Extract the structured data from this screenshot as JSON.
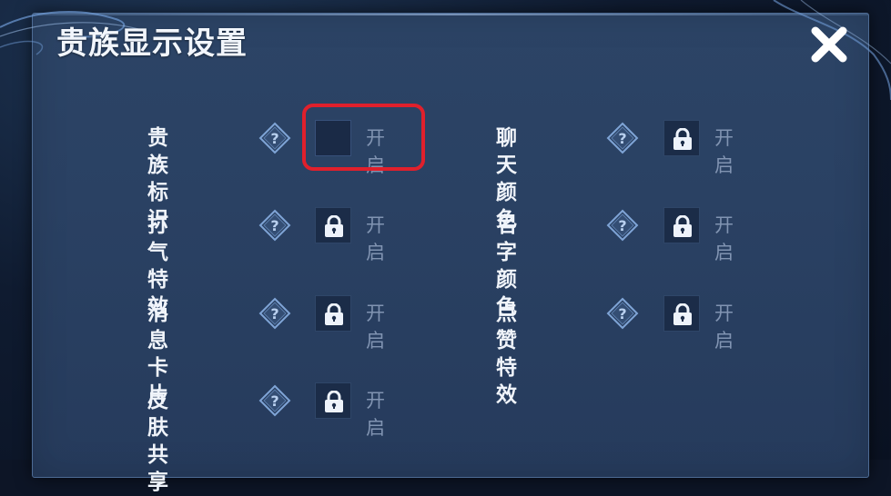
{
  "dialog": {
    "title": "贵族显示设置",
    "close_icon": "close-icon"
  },
  "options": [
    {
      "label": "贵族标识",
      "state": "开启",
      "locked": false,
      "column": "left"
    },
    {
      "label": "聊天颜色",
      "state": "开启",
      "locked": true,
      "column": "right"
    },
    {
      "label": "打气特效",
      "state": "开启",
      "locked": true,
      "column": "left"
    },
    {
      "label": "名字颜色",
      "state": "开启",
      "locked": true,
      "column": "right"
    },
    {
      "label": "消息卡片",
      "state": "开启",
      "locked": true,
      "column": "left"
    },
    {
      "label": "点赞特效",
      "state": "开启",
      "locked": true,
      "column": "right"
    },
    {
      "label": "皮肤共享",
      "state": "开启",
      "locked": true,
      "column": "left"
    }
  ],
  "icons": {
    "help": "question-diamond-icon",
    "lock": "lock-icon"
  },
  "colors": {
    "panel": "#2a4163",
    "highlight": "#e0202c",
    "label": "#f0f4fa",
    "state_text": "#8194b2"
  }
}
